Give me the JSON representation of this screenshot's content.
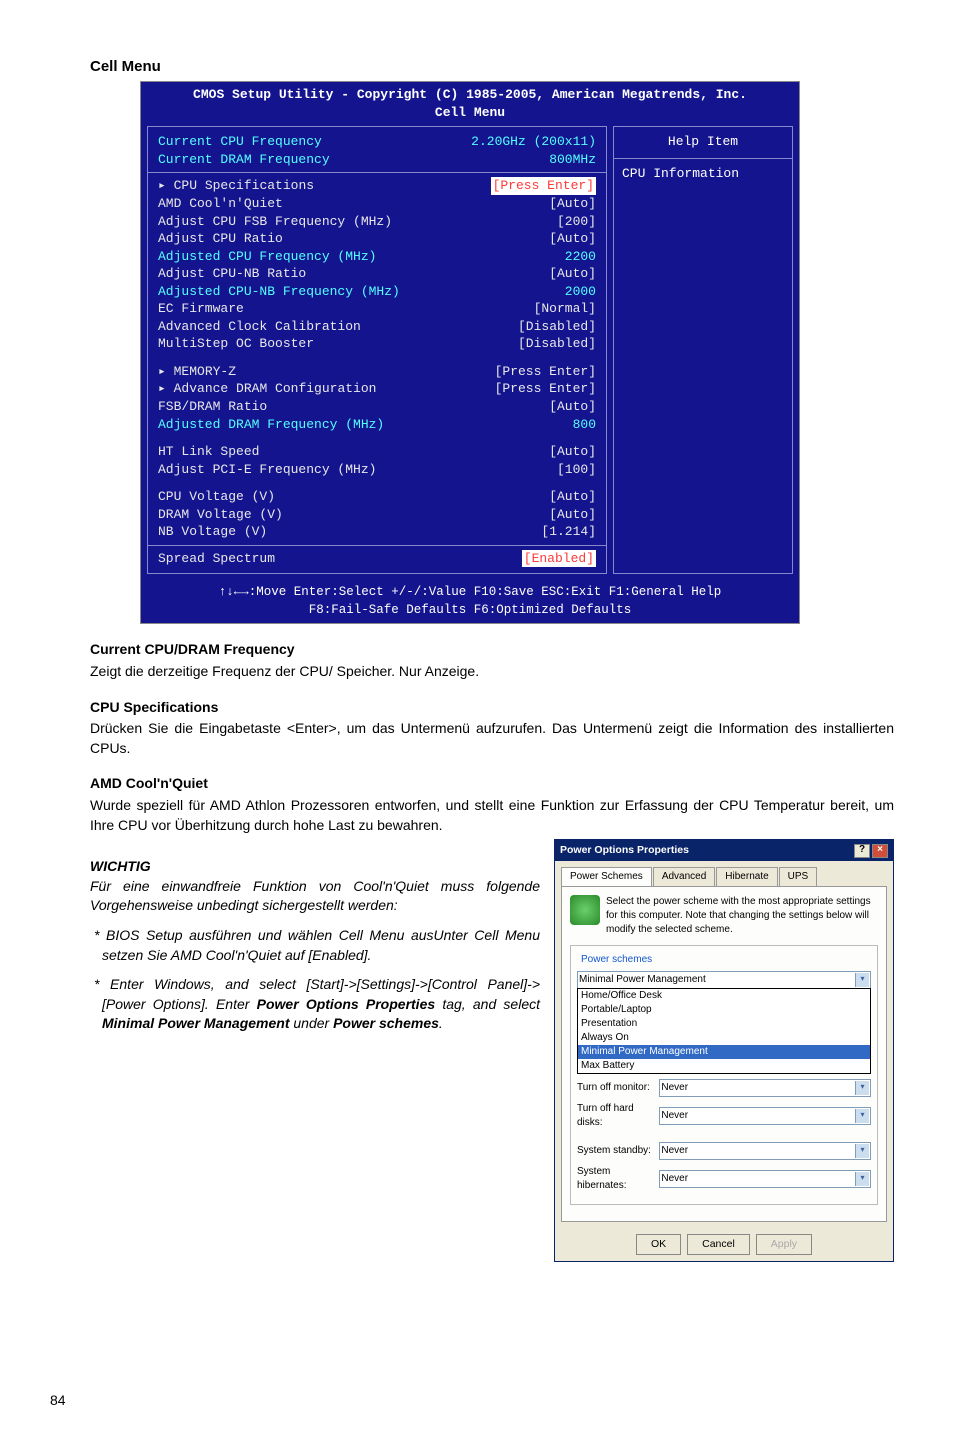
{
  "page_number": "84",
  "heading_cell_menu": "Cell Menu",
  "bios": {
    "title_line1": "CMOS Setup Utility - Copyright (C) 1985-2005, American Megatrends, Inc.",
    "title_line2": "Cell Menu",
    "help_title": "Help Item",
    "help_text": "CPU Information",
    "footer_line1": "↑↓←→:Move  Enter:Select  +/-/:Value  F10:Save  ESC:Exit  F1:General Help",
    "footer_line2": "F8:Fail-Safe Defaults    F6:Optimized Defaults",
    "rows": [
      {
        "label": "Current CPU Frequency",
        "value": "2.20GHz (200x11)",
        "cyan": true
      },
      {
        "label": "Current DRAM Frequency",
        "value": "800MHz",
        "cyan": true
      },
      {
        "divider": true
      },
      {
        "label": "▸ CPU Specifications",
        "value": "[Press Enter]",
        "hl": true
      },
      {
        "label": "AMD Cool'n'Quiet",
        "value": "[Auto]"
      },
      {
        "label": "Adjust CPU FSB Frequency (MHz)",
        "value": "[200]"
      },
      {
        "label": "Adjust CPU Ratio",
        "value": "[Auto]"
      },
      {
        "label": "Adjusted CPU Frequency (MHz)",
        "value": "2200",
        "cyan": true
      },
      {
        "label": "Adjust CPU-NB Ratio",
        "value": "[Auto]"
      },
      {
        "label": "Adjusted CPU-NB Frequency (MHz)",
        "value": "2000",
        "cyan": true
      },
      {
        "label": "EC Firmware",
        "value": "[Normal]"
      },
      {
        "label": "Advanced Clock Calibration",
        "value": "[Disabled]"
      },
      {
        "label": "MultiStep OC Booster",
        "value": "[Disabled]"
      },
      {
        "spacer": true
      },
      {
        "label": "▸ MEMORY-Z",
        "value": "[Press Enter]"
      },
      {
        "label": "▸ Advance DRAM Configuration",
        "value": "[Press Enter]"
      },
      {
        "label": "FSB/DRAM Ratio",
        "value": "[Auto]"
      },
      {
        "label": "Adjusted DRAM Frequency (MHz)",
        "value": "800",
        "cyan": true
      },
      {
        "spacer": true
      },
      {
        "label": "HT Link Speed",
        "value": "[Auto]"
      },
      {
        "label": "Adjust PCI-E Frequency (MHz)",
        "value": "[100]"
      },
      {
        "spacer": true
      },
      {
        "label": "CPU Voltage (V)",
        "value": "[Auto]"
      },
      {
        "label": "DRAM Voltage (V)",
        "value": "[Auto]"
      },
      {
        "label": "NB Voltage (V)",
        "value": "[1.214]"
      },
      {
        "divider": true
      },
      {
        "label": "Spread Spectrum",
        "value": "[Enabled]",
        "hl": true
      }
    ]
  },
  "sections": {
    "current_freq": {
      "heading": "Current CPU/DRAM Frequency",
      "text": "Zeigt die derzeitige Frequenz der CPU/ Speicher. Nur Anzeige."
    },
    "cpu_spec": {
      "heading": "CPU Specifications",
      "text": "Drücken Sie die Eingabetaste <Enter>, um das Untermenü aufzurufen. Das Untermenü zeigt die Information des installierten CPUs."
    },
    "amd_cnq": {
      "heading": "AMD Cool'n'Quiet",
      "text": "Wurde speziell für AMD Athlon Prozessoren entworfen, und stellt eine Funktion zur Erfassung der CPU Temperatur bereit, um Ihre CPU vor Überhitzung durch hohe Last zu bewahren."
    }
  },
  "wichtig_label": "WICHTIG",
  "wichtig_intro": "Für eine einwandfreie Funktion von Cool'n'Quiet muss folgende Vorgehensweise unbedingt sichergestellt werden:",
  "bullet1": "* BIOS Setup ausführen und wählen Cell Menu ausUnter Cell Menu setzen Sie AMD Cool'n'Quiet auf [Enabled].",
  "bullet2_pre": "* Enter Windows, and select [Start]->[Settings]->[Control Panel]->[Power Options]. Enter ",
  "bullet2_bold1": "Power Options Properties",
  "bullet2_mid": " tag, and select ",
  "bullet2_bold2": "Minimal Power Management",
  "bullet2_mid2": " under ",
  "bullet2_bold3": "Power schemes",
  "bullet2_end": ".",
  "dialog": {
    "title": "Power Options Properties",
    "tabs": [
      "Power Schemes",
      "Advanced",
      "Hibernate",
      "UPS"
    ],
    "desc": "Select the power scheme with the most appropriate settings for this computer. Note that changing the settings below will modify the selected scheme.",
    "legend1": "Power schemes",
    "selected_scheme": "Minimal Power Management",
    "scheme_options": [
      "Home/Office Desk",
      "Portable/Laptop",
      "Presentation",
      "Always On",
      "Minimal Power Management",
      "Max Battery"
    ],
    "field_monitor_label": "Turn off monitor:",
    "field_monitor_value": "Never",
    "field_hd_label": "Turn off hard disks:",
    "field_hd_value": "Never",
    "field_standby_label": "System standby:",
    "field_standby_value": "Never",
    "field_hib_label": "System hibernates:",
    "field_hib_value": "Never",
    "btn_ok": "OK",
    "btn_cancel": "Cancel",
    "btn_apply": "Apply"
  }
}
